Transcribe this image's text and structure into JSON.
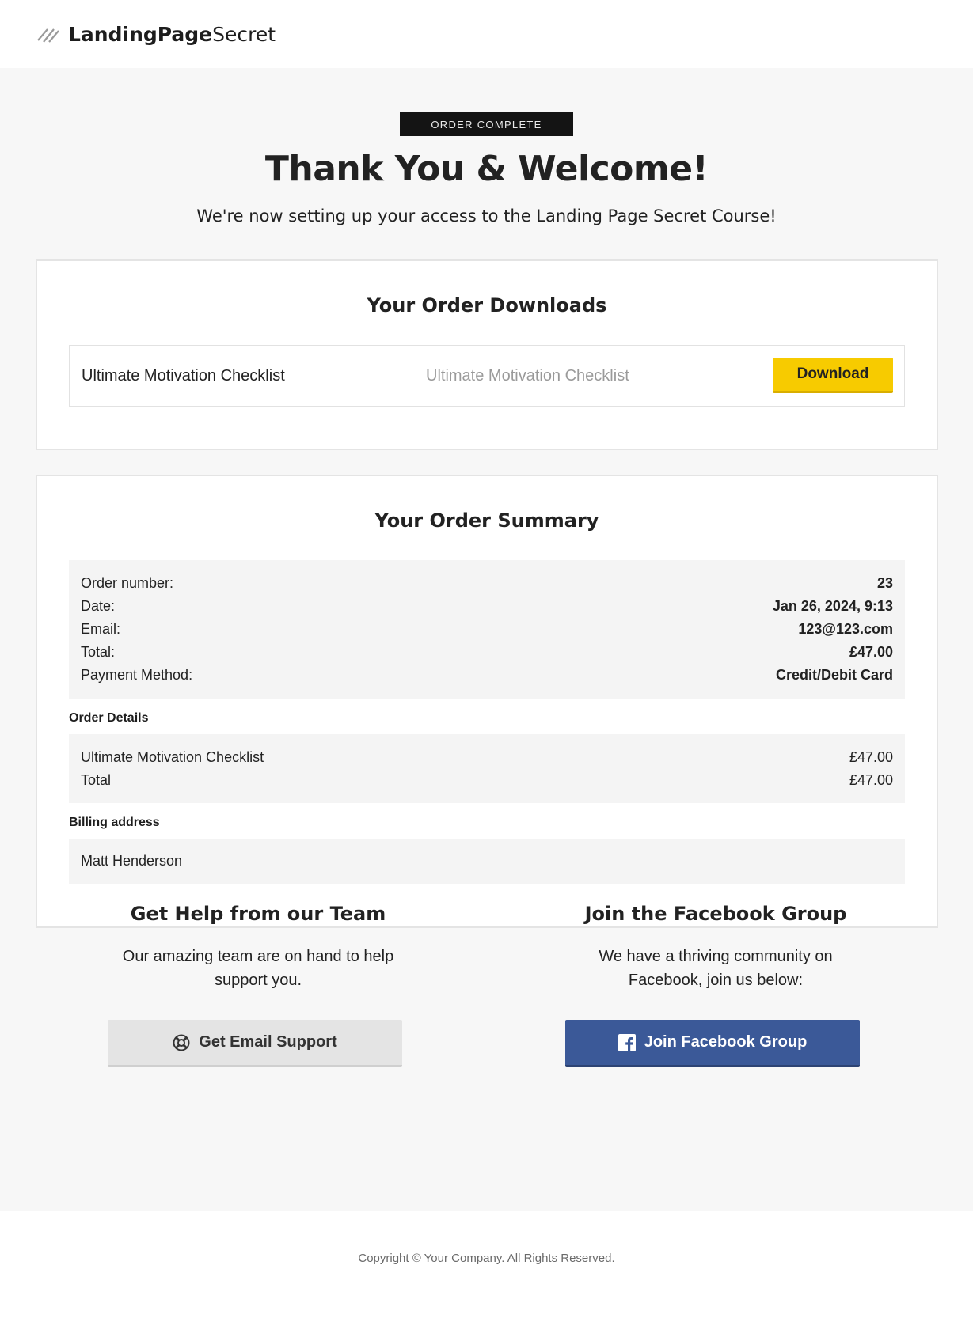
{
  "header": {
    "logo_bold": "LandingPage",
    "logo_light": "Secret"
  },
  "hero": {
    "badge": "ORDER COMPLETE",
    "title": "Thank You & Welcome!",
    "subtitle": "We're now setting up your access to the Landing Page Secret Course!"
  },
  "downloads": {
    "title": "Your Order Downloads",
    "items": [
      {
        "product": "Ultimate Motivation Checklist",
        "file": "Ultimate Motivation Checklist",
        "button_label": "Download"
      }
    ],
    "button_color": "#f7cb00"
  },
  "summary": {
    "title": "Your Order Summary",
    "rows": [
      {
        "label": "Order number:",
        "value": "23"
      },
      {
        "label": "Date:",
        "value": "Jan 26, 2024, 9:13"
      },
      {
        "label": "Email:",
        "value": "123@123.com"
      },
      {
        "label": "Total:",
        "value": "£47.00"
      },
      {
        "label": "Payment Method:",
        "value": "Credit/Debit Card"
      }
    ],
    "details_label": "Order Details",
    "details": [
      {
        "label": "Ultimate Motivation Checklist",
        "value": "£47.00"
      },
      {
        "label": "Total",
        "value": "£47.00"
      }
    ],
    "billing_label": "Billing address",
    "billing_name": "Matt Henderson"
  },
  "help": {
    "title": "Get Help from our Team",
    "text": "Our amazing team are on hand to help support you.",
    "button_label": "Get Email Support",
    "button_icon": "lifebuoy-icon"
  },
  "facebook": {
    "title": "Join the Facebook Group",
    "text": "We have a thriving community on Facebook, join us below:",
    "button_label": "Join Facebook Group",
    "button_icon": "facebook-icon",
    "button_color": "#3b5998"
  },
  "footer": {
    "copyright": "Copyright © Your Company.  All Rights Reserved."
  }
}
